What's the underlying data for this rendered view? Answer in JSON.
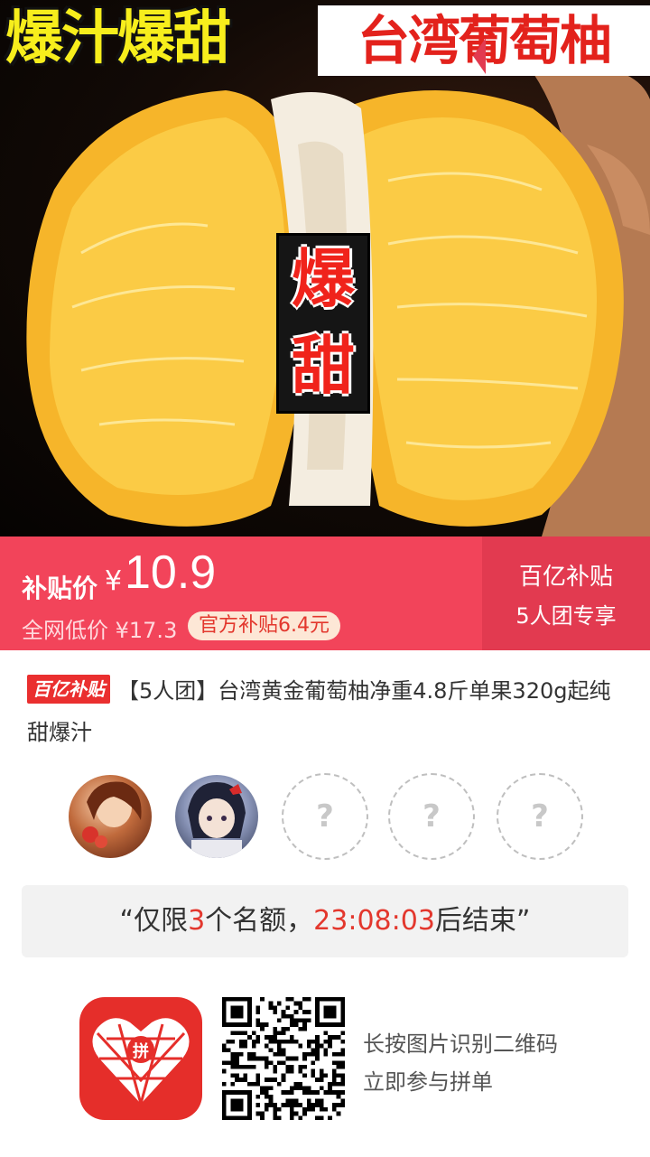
{
  "hero": {
    "title_left": "爆汁爆甜",
    "title_right": "台湾葡萄柚",
    "badge_chars": [
      "爆",
      "甜"
    ]
  },
  "price": {
    "label": "补贴价",
    "currency": "¥",
    "value": "10.9",
    "original": "全网低价 ¥17.3",
    "subsidy_tag": "官方补贴6.4元",
    "billion_subsidy": "百亿补贴",
    "group_only": "5人团专享"
  },
  "product": {
    "badge": "百亿补贴",
    "title": "【5人团】台湾黄金葡萄柚净重4.8斤单果320g起纯甜爆汁"
  },
  "group": {
    "joined": 2,
    "slots": [
      "?",
      "?",
      "?"
    ]
  },
  "countdown": {
    "open_quote": "“",
    "prefix": "仅限",
    "count": "3",
    "mid": "个名额，",
    "time": "23:08:03",
    "suffix": "后结束",
    "close_quote": "”"
  },
  "footer": {
    "line1": "长按图片识别二维码",
    "line2": "立即参与拼单"
  },
  "colors": {
    "price_bar": "#f2445a",
    "price_bar_right": "#e23a50",
    "accent_red": "#e3372d",
    "app_logo": "#e52e2a"
  }
}
